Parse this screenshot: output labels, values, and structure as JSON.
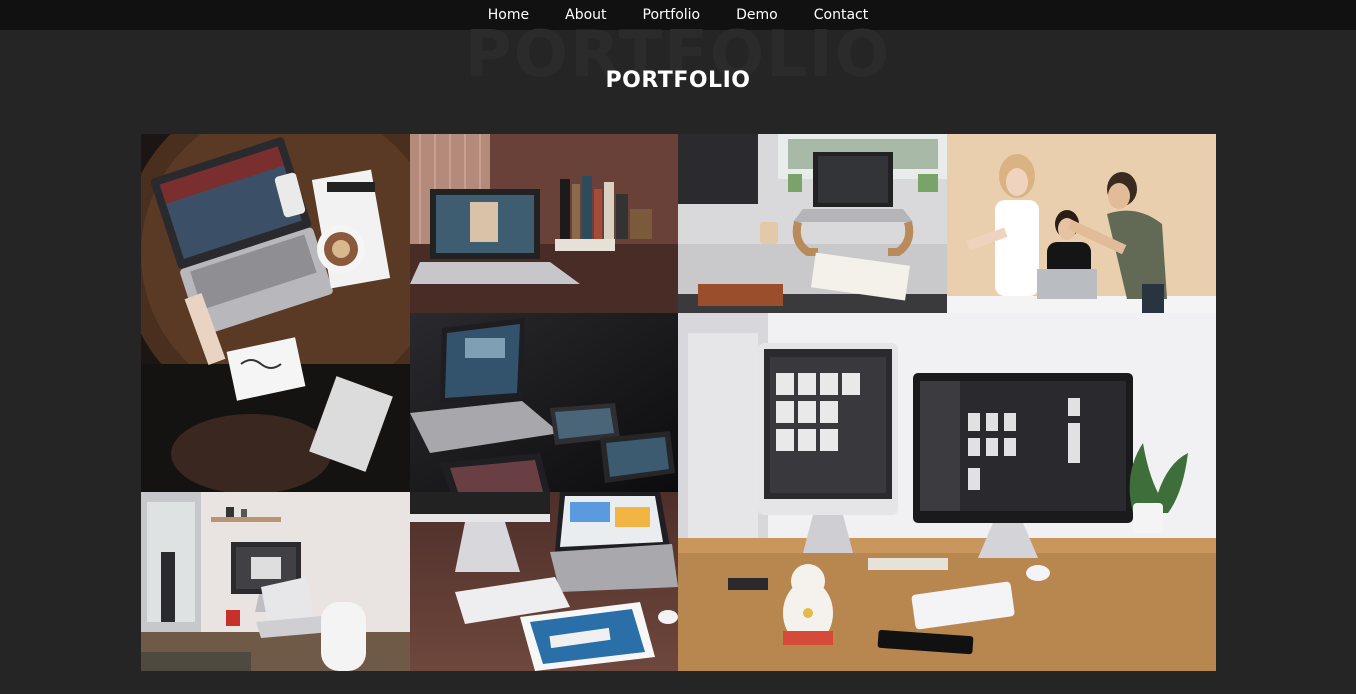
{
  "nav": {
    "items": [
      {
        "label": "Home"
      },
      {
        "label": "About"
      },
      {
        "label": "Portfolio"
      },
      {
        "label": "Demo"
      },
      {
        "label": "Contact"
      }
    ]
  },
  "portfolio": {
    "bg_heading": "PORTFOLIO",
    "title": "PORTFOLIO"
  },
  "colors": {
    "page_bg": "#252525",
    "nav_bg": "#111111",
    "title_text": "#ffffff"
  },
  "gallery": {
    "photos": [
      {
        "name": "workspace-laptop-coffee-photo"
      },
      {
        "name": "laptop-desk-books-photo"
      },
      {
        "name": "laptop-stand-notebook-photo"
      },
      {
        "name": "team-meeting-laptop-photo"
      },
      {
        "name": "laptop-tablets-dark-photo"
      },
      {
        "name": "imac-monitors-desk-photo"
      },
      {
        "name": "office-imac-macbook-photo"
      },
      {
        "name": "imac-macbook-ipad-photo"
      }
    ]
  }
}
